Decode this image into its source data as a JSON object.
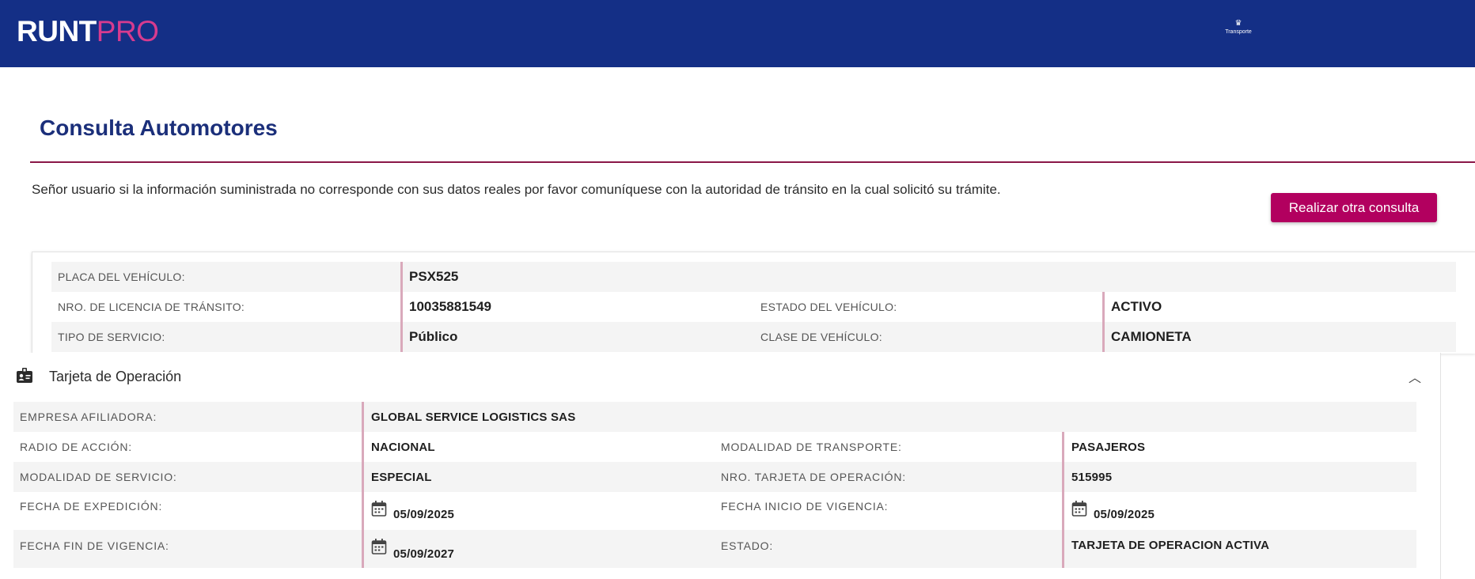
{
  "header": {
    "logo_runt": "RUNT",
    "logo_pro": "PRO",
    "ministry_label": "Transporte",
    "background": "#142f86",
    "accent": "#d63b8f"
  },
  "page": {
    "title": "Consulta Automotores",
    "notice": "Señor usuario si la información suministrada no corresponde con sus datos reales por favor comuníquese con la autoridad de tránsito en la cual solicitó su trámite.",
    "button_label": "Realizar otra consulta",
    "button_color": "#b2005f"
  },
  "vehicle": {
    "plate_label": "PLACA DEL VEHÍCULO:",
    "plate_value": "PSX525",
    "license_label": "NRO. DE LICENCIA DE TRÁNSITO:",
    "license_value": "10035881549",
    "status_label": "ESTADO DEL VEHÍCULO:",
    "status_value": "ACTIVO",
    "service_label": "TIPO DE SERVICIO:",
    "service_value": "Público",
    "class_label": "CLASE DE VEHÍCULO:",
    "class_value": "CAMIONETA"
  },
  "operation_card": {
    "section_title": "Tarjeta de Operación",
    "icon": "id-card-icon",
    "company_label": "EMPRESA AFILIADORA:",
    "company_value": "GLOBAL SERVICE LOGISTICS SAS",
    "range_label": "RADIO DE ACCIÓN:",
    "range_value": "NACIONAL",
    "transport_mode_label": "MODALIDAD DE TRANSPORTE:",
    "transport_mode_value": "PASAJEROS",
    "service_mode_label": "MODALIDAD DE SERVICIO:",
    "service_mode_value": "ESPECIAL",
    "card_number_label": "NRO. TARJETA DE OPERACIÓN:",
    "card_number_value": "515995",
    "issue_date_label": "FECHA DE EXPEDICIÓN:",
    "issue_date_value": "05/09/2025",
    "start_date_label": "FECHA INICIO DE VIGENCIA:",
    "start_date_value": "05/09/2025",
    "end_date_label": "FECHA FIN DE VIGENCIA:",
    "end_date_value": "05/09/2027",
    "state_label": "ESTADO:",
    "state_value": "TARJETA DE OPERACION ACTIVA"
  }
}
